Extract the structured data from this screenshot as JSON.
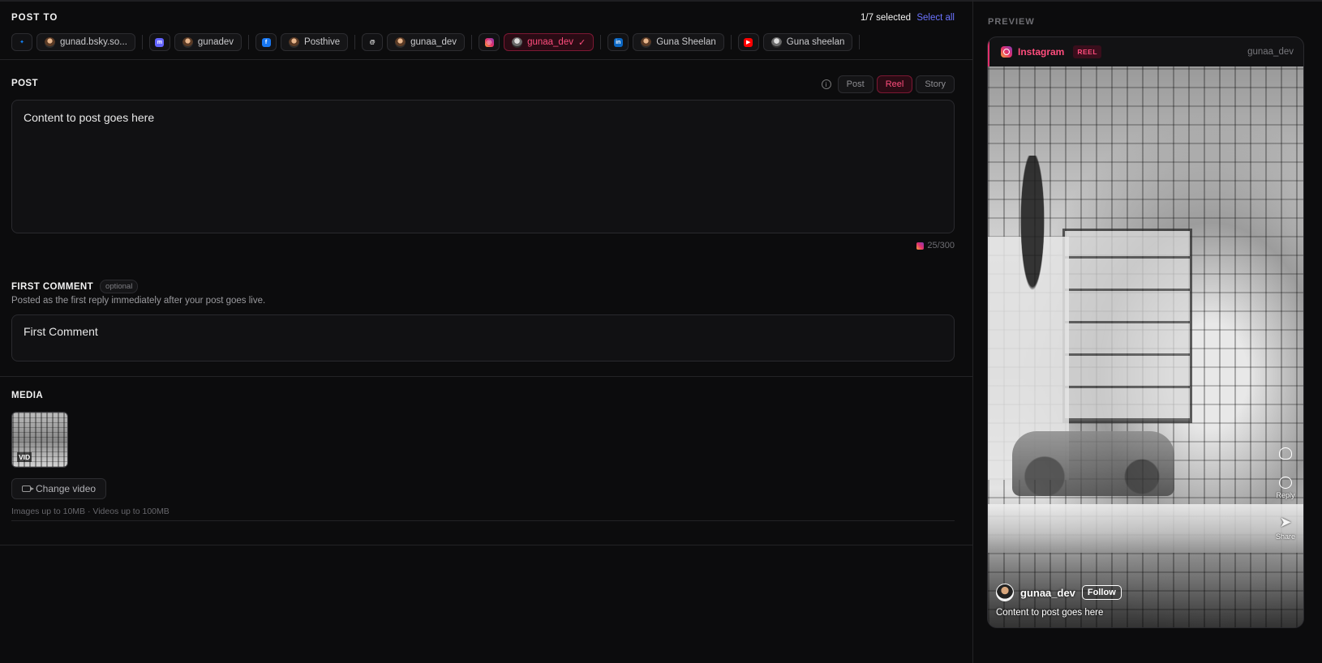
{
  "post_to": {
    "title": "POST TO",
    "selected_count": "1/7 selected",
    "select_all": "Select all",
    "groups": [
      {
        "platform": "bluesky",
        "icon": "bluesky-icon",
        "color": "#1185fe",
        "accounts": [
          {
            "name": "gunad.bsky.so...",
            "selected": false
          }
        ]
      },
      {
        "platform": "mastodon",
        "icon": "mastodon-icon",
        "color": "#6364ff",
        "accounts": [
          {
            "name": "gunadev",
            "selected": false
          }
        ]
      },
      {
        "platform": "facebook",
        "icon": "facebook-icon",
        "color": "#1877f2",
        "accounts": [
          {
            "name": "Posthive",
            "selected": false
          }
        ]
      },
      {
        "platform": "threads",
        "icon": "threads-icon",
        "color": "#ffffff",
        "accounts": [
          {
            "name": "gunaa_dev",
            "selected": false
          }
        ]
      },
      {
        "platform": "instagram",
        "icon": "instagram-icon",
        "color": "#e1306c",
        "accounts": [
          {
            "name": "gunaa_dev",
            "selected": true
          }
        ]
      },
      {
        "platform": "linkedin",
        "icon": "linkedin-icon",
        "color": "#0a66c2",
        "accounts": [
          {
            "name": "Guna Sheelan",
            "selected": false
          }
        ]
      },
      {
        "platform": "youtube",
        "icon": "youtube-icon",
        "color": "#ff0000",
        "accounts": [
          {
            "name": "Guna sheelan",
            "selected": false
          }
        ]
      }
    ]
  },
  "post": {
    "title": "POST",
    "types": [
      {
        "label": "Post",
        "active": false
      },
      {
        "label": "Reel",
        "active": true
      },
      {
        "label": "Story",
        "active": false
      }
    ],
    "content": "Content to post goes here",
    "counter": "25/300"
  },
  "first_comment": {
    "title": "FIRST COMMENT",
    "optional_badge": "optional",
    "description": "Posted as the first reply immediately after your post goes live.",
    "value": "First Comment"
  },
  "media": {
    "title": "MEDIA",
    "thumb_badge": "VID",
    "change_video": "Change video",
    "limits": "Images up to 10MB · Videos up to 100MB"
  },
  "preview": {
    "title": "PREVIEW",
    "platform": "Instagram",
    "type_badge": "REEL",
    "username": "gunaa_dev",
    "actions": [
      {
        "icon": "heart-icon",
        "label": ""
      },
      {
        "icon": "reply-icon",
        "label": "Reply"
      },
      {
        "icon": "share-icon",
        "label": "Share"
      }
    ],
    "reel_username": "gunaa_dev",
    "follow": "Follow",
    "caption": "Content to post goes here"
  },
  "colors": {
    "accent_pink": "#ff4d7d",
    "link_blue": "#6b73ff",
    "background": "#0c0c0d"
  }
}
